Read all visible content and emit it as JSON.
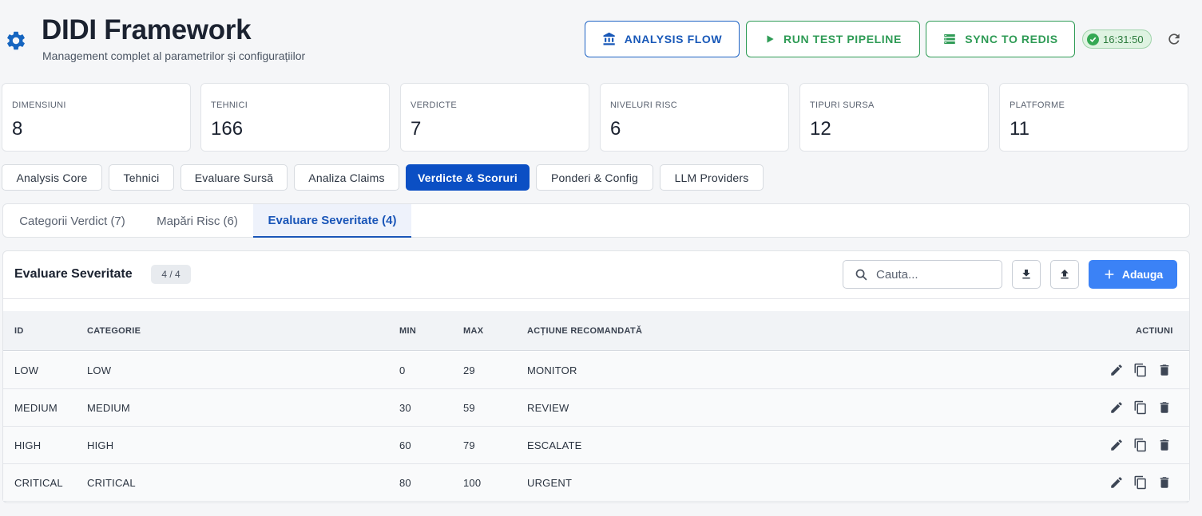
{
  "header": {
    "title": "DIDI Framework",
    "subtitle": "Management complet al parametrilor și configurațiilor",
    "buttons": {
      "analysis_flow": "ANALYSIS FLOW",
      "run_test": "RUN TEST PIPELINE",
      "sync_redis": "SYNC TO REDIS"
    },
    "status_time": "16:31:50"
  },
  "stats": [
    {
      "label": "DIMENSIUNI",
      "value": "8"
    },
    {
      "label": "TEHNICI",
      "value": "166"
    },
    {
      "label": "VERDICTE",
      "value": "7"
    },
    {
      "label": "NIVELURI RISC",
      "value": "6"
    },
    {
      "label": "TIPURI SURSA",
      "value": "12"
    },
    {
      "label": "PLATFORME",
      "value": "11"
    }
  ],
  "main_tabs": [
    {
      "label": "Analysis Core"
    },
    {
      "label": "Tehnici"
    },
    {
      "label": "Evaluare Sursă"
    },
    {
      "label": "Analiza Claims"
    },
    {
      "label": "Verdicte & Scoruri"
    },
    {
      "label": "Ponderi & Config"
    },
    {
      "label": "LLM Providers"
    }
  ],
  "sub_tabs": [
    {
      "label": "Categorii Verdict (7)"
    },
    {
      "label": "Mapări Risc (6)"
    },
    {
      "label": "Evaluare Severitate (4)"
    }
  ],
  "panel": {
    "title": "Evaluare Severitate",
    "count": "4 / 4",
    "search_placeholder": "Cauta...",
    "add_label": "Adauga"
  },
  "table": {
    "headers": {
      "id": "ID",
      "categorie": "CATEGORIE",
      "min": "MIN",
      "max": "MAX",
      "actiune": "ACȚIUNE RECOMANDATĂ",
      "actiuni": "ACTIUNI"
    },
    "rows": [
      {
        "id": "LOW",
        "categorie": "LOW",
        "min": "0",
        "max": "29",
        "actiune": "MONITOR"
      },
      {
        "id": "MEDIUM",
        "categorie": "MEDIUM",
        "min": "30",
        "max": "59",
        "actiune": "REVIEW"
      },
      {
        "id": "HIGH",
        "categorie": "HIGH",
        "min": "60",
        "max": "79",
        "actiune": "ESCALATE"
      },
      {
        "id": "CRITICAL",
        "categorie": "CRITICAL",
        "min": "80",
        "max": "100",
        "actiune": "URGENT"
      }
    ]
  },
  "colors": {
    "primary": "#0b4fc4",
    "success": "#2e9b55",
    "add_button": "#3b82f6"
  },
  "icons": [
    "gear-icon",
    "bank-icon",
    "play-icon",
    "list-icon",
    "check-circle-icon",
    "refresh-icon",
    "search-icon",
    "download-icon",
    "upload-icon",
    "plus-icon",
    "edit-icon",
    "copy-icon",
    "delete-icon"
  ]
}
